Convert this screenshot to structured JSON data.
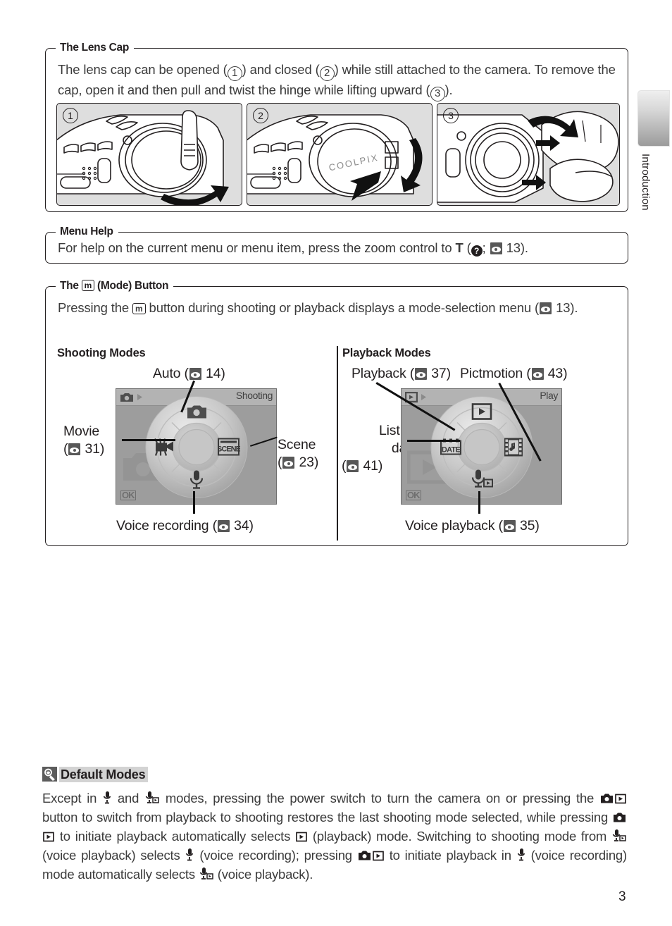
{
  "page": {
    "number": "3",
    "side_tab_label": "Introduction"
  },
  "lens_cap": {
    "title": "The Lens Cap",
    "body_part1": "The lens cap can be opened (",
    "body_part2": ") and closed (",
    "body_part3": ") while still attached to the camera.  To remove the cap, open it and then pull and twist the hinge while lifting upward (",
    "body_part4": ").",
    "marker1": "1",
    "marker2": "2",
    "marker3": "3",
    "figures": [
      {
        "num": "1",
        "caption": "camera with lens cap being opened, arrow curving up-right"
      },
      {
        "num": "2",
        "caption": "camera with COOLPIX lens cap closed, arrow curving down-left",
        "cap_text": "COOLPIX"
      },
      {
        "num": "3",
        "caption": "hand twisting hinge off the lens barrel, rotation arrow"
      }
    ]
  },
  "menu_help": {
    "title": "Menu Help",
    "body_before_T": "For help on the current menu or menu item, press the zoom control to ",
    "T": "T",
    "body_after_T": " (",
    "help_icon": "?",
    "semicolon": "; ",
    "page_ref": "13",
    "tail": ")."
  },
  "mode_button": {
    "title_prefix": "The ",
    "title_button": "m",
    "title_suffix": " (Mode) Button",
    "body_before": "Pressing the ",
    "body_button": "m",
    "body_after": " button during shooting or playback displays a mode-selection menu (",
    "page_ref": "13",
    "tail": ")."
  },
  "shooting": {
    "heading": "Shooting Modes",
    "lcd": {
      "topbar_text": "Shooting",
      "topbar_icon": "camera-icon",
      "ok_label": "OK",
      "background_icon": "camera-icon"
    },
    "labels": [
      {
        "name": "auto",
        "text": "Auto (",
        "page": "14",
        "tail": ")",
        "icon": "camera-icon",
        "position": "top"
      },
      {
        "name": "movie",
        "line1": "Movie",
        "line2_open": "(",
        "page": "31",
        "tail": ")",
        "icon": "movie-camera-icon",
        "position": "left"
      },
      {
        "name": "scene",
        "line1": "Scene",
        "line2_open": "(",
        "page": "23",
        "tail": ")",
        "icon": "scene-icon",
        "icon_text": "SCENE",
        "position": "right"
      },
      {
        "name": "voice-recording",
        "text": "Voice recording (",
        "page": "34",
        "tail": ")",
        "icon": "microphone-icon",
        "position": "bottom"
      }
    ]
  },
  "playback": {
    "heading": "Playback Modes",
    "lcd": {
      "topbar_text": "Play",
      "topbar_icon": "playback-icon",
      "ok_label": "OK",
      "background_icon": "playback-icon"
    },
    "labels": [
      {
        "name": "playback",
        "text": "Playback (",
        "page": "37",
        "tail": ")",
        "icon": "playback-icon",
        "position": "top"
      },
      {
        "name": "pictmotion",
        "text": "Pictmotion (",
        "page": "43",
        "tail": ")",
        "icon": "pictmotion-icon",
        "position": "top-right"
      },
      {
        "name": "list-by-date",
        "line1": "List by",
        "line2": "date",
        "line3_open": "(",
        "page": "41",
        "tail": ")",
        "icon": "date-icon",
        "icon_text": "DATE",
        "position": "left"
      },
      {
        "name": "voice-playback",
        "text": "Voice playback (",
        "page": "35",
        "tail": ")",
        "icon": "voice-playback-icon",
        "position": "bottom"
      }
    ]
  },
  "default_modes": {
    "icon": "note-pencil-icon",
    "heading": "Default Modes",
    "body": [
      {
        "t": "Except in "
      },
      {
        "icon": "microphone-icon"
      },
      {
        "t": " and "
      },
      {
        "icon": "voice-playback-icon"
      },
      {
        "t": " modes, pressing the power switch to turn the camera on or pressing the "
      },
      {
        "icon": "camera-icon-solid"
      },
      {
        "icon": "playback-icon-box"
      },
      {
        "t": " button to switch from playback to shooting restores the last shooting mode selected, while pressing "
      },
      {
        "icon": "camera-icon-solid"
      },
      {
        "icon": "playback-icon-box"
      },
      {
        "t": " to initiate playback automatically selects "
      },
      {
        "icon": "playback-icon-box"
      },
      {
        "t": " (playback) mode.  Switching to shooting mode from "
      },
      {
        "icon": "voice-playback-icon"
      },
      {
        "t": " (voice playback) selects "
      },
      {
        "icon": "microphone-icon"
      },
      {
        "t": " (voice recording); pressing "
      },
      {
        "icon": "camera-icon-solid"
      },
      {
        "icon": "playback-icon-box"
      },
      {
        "t": " to initiate playback in "
      },
      {
        "icon": "microphone-icon"
      },
      {
        "t": " (voice recording) mode automatically selects "
      },
      {
        "icon": "voice-playback-icon"
      },
      {
        "t": " (voice playback)."
      }
    ],
    "text_flat": "Except in   and   modes, pressing the power switch to turn the camera on or pressing the    button to switch from playback to shooting restores the last shooting mode selected, while pressing    to initiate playback automatically selects   (playback) mode.  Switching to shooting mode from   (voice playback) selects   (voice recording); pressing    to initiate playback in   (voice recording) mode automatically selects   (voice playback)."
  },
  "colors": {
    "ink": "#231f20",
    "body_gray": "#3b3b3b",
    "lcd_bg": "#9d9d9d",
    "lcd_topbar": "#b3b3b3",
    "fig_bg": "#dedede",
    "highlight": "#d3d3d3"
  }
}
